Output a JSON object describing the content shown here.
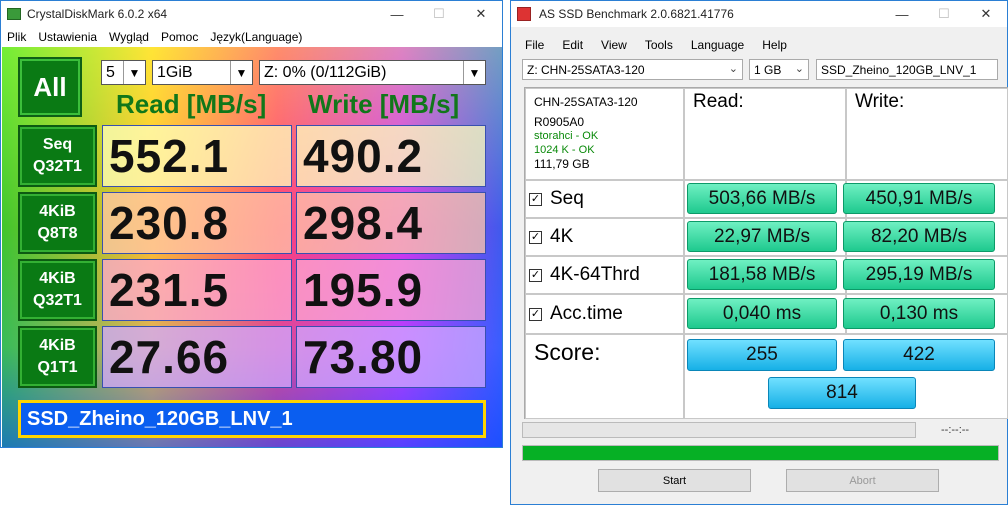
{
  "cdm": {
    "title": "CrystalDiskMark 6.0.2 x64",
    "menu": [
      "Plik",
      "Ustawienia",
      "Wygląd",
      "Pomoc",
      "Język(Language)"
    ],
    "all_label": "All",
    "count": "5",
    "size": "1GiB",
    "drive": "Z: 0% (0/112GiB)",
    "read_header": "Read [MB/s]",
    "write_header": "Write [MB/s]",
    "rows": [
      {
        "l1": "Seq",
        "l2": "Q32T1",
        "read": "552.1",
        "write": "490.2"
      },
      {
        "l1": "4KiB",
        "l2": "Q8T8",
        "read": "230.8",
        "write": "298.4"
      },
      {
        "l1": "4KiB",
        "l2": "Q32T1",
        "read": "231.5",
        "write": "195.9"
      },
      {
        "l1": "4KiB",
        "l2": "Q1T1",
        "read": "27.66",
        "write": "73.80"
      }
    ],
    "comment": "SSD_Zheino_120GB_LNV_1"
  },
  "asd": {
    "title": "AS SSD Benchmark 2.0.6821.41776",
    "menu": [
      "File",
      "Edit",
      "View",
      "Tools",
      "Language",
      "Help"
    ],
    "drive": "Z: CHN-25SATA3-120",
    "size": "1 GB",
    "name": "SSD_Zheino_120GB_LNV_1",
    "info": {
      "model": "CHN-25SATA3-120",
      "fw": "R0905A0",
      "driver": "storahci - OK",
      "align": "1024 K - OK",
      "capacity": "111,79 GB"
    },
    "read_header": "Read:",
    "write_header": "Write:",
    "rows": [
      {
        "label": "Seq",
        "read": "503,66 MB/s",
        "write": "450,91 MB/s"
      },
      {
        "label": "4K",
        "read": "22,97 MB/s",
        "write": "82,20 MB/s"
      },
      {
        "label": "4K-64Thrd",
        "read": "181,58 MB/s",
        "write": "295,19 MB/s"
      },
      {
        "label": "Acc.time",
        "read": "0,040 ms",
        "write": "0,130 ms"
      }
    ],
    "score_label": "Score:",
    "score_read": "255",
    "score_write": "422",
    "score_total": "814",
    "time": "--:--:--",
    "start": "Start",
    "abort": "Abort",
    "progress": 1.0,
    "colors": {
      "progress": "#06b025"
    }
  }
}
